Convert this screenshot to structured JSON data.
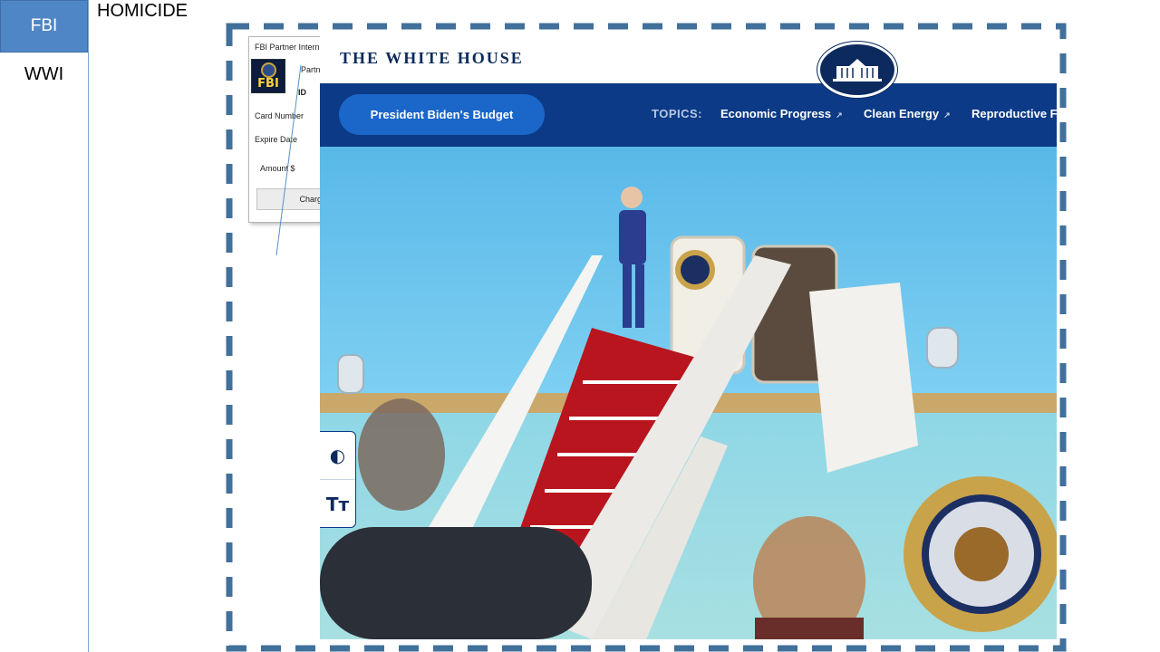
{
  "sidebar": {
    "items": [
      {
        "label": "FBI",
        "selected": true
      },
      {
        "label": "WWI",
        "selected": false
      }
    ]
  },
  "heading": "HOMICIDE",
  "colors": {
    "sidebar_selected": "#4f86c6",
    "dash_frame": "#41709b",
    "wh_navy": "#0c3a86",
    "wh_button": "#1a66c9"
  },
  "fbi_popup": {
    "window_title": "FBI Partner Intern",
    "logo_text": "FBI",
    "partner_label": "Partn",
    "id_label": "ID",
    "card_number_label": "Card Number",
    "expire_date_label": "Expire Date",
    "amount_label": "Amount $",
    "charge_button": "Charge"
  },
  "whitehouse": {
    "site_title": "THE WHITE HOUSE",
    "seal_icon": "white-house-seal-icon",
    "budget_button": "President Biden's Budget",
    "topics_label": "TOPICS:",
    "topics": [
      {
        "label": "Economic Progress",
        "icon": "external-arrow-icon"
      },
      {
        "label": "Clean Energy",
        "icon": "external-arrow-icon"
      },
      {
        "label": "Reproductive F",
        "icon": ""
      }
    ]
  },
  "accessibility_tools": [
    {
      "name": "contrast-toggle",
      "glyph": "◐"
    },
    {
      "name": "text-size-toggle",
      "glyph": "Tт"
    }
  ]
}
